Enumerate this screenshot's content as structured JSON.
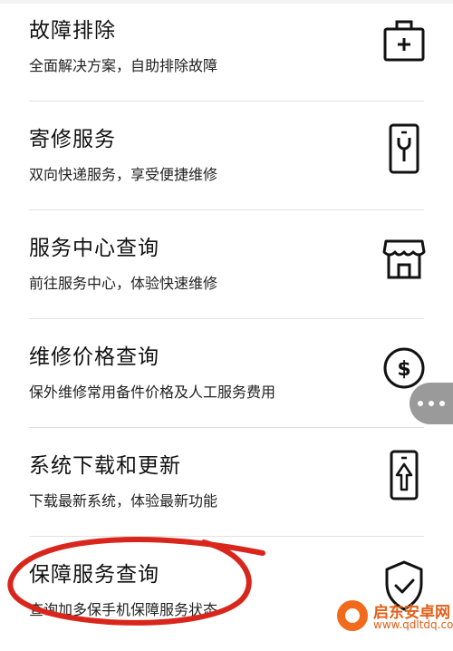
{
  "items": [
    {
      "title": "故障排除",
      "subtitle": "全面解决方案，自助排除故障",
      "icon": "first-aid-kit-icon"
    },
    {
      "title": "寄修服务",
      "subtitle": "双向快递服务，享受便捷维修",
      "icon": "phone-repair-icon"
    },
    {
      "title": "服务中心查询",
      "subtitle": "前往服务中心，体验快速维修",
      "icon": "store-icon"
    },
    {
      "title": "维修价格查询",
      "subtitle": "保外维修常用备件价格及人工服务费用",
      "icon": "dollar-icon"
    },
    {
      "title": "系统下载和更新",
      "subtitle": "下载最新系统，体验最新功能",
      "icon": "phone-update-icon"
    },
    {
      "title": "保障服务查询",
      "subtitle": "查询加多保手机保障服务状态",
      "icon": "shield-check-icon"
    }
  ],
  "floating_button": {
    "icon": "more-dots-icon"
  },
  "annotation": {
    "color": "#d9261c",
    "shape": "hand-drawn-circle"
  },
  "watermark": {
    "name": "启东安卓网",
    "url": "www.qdltdq.com",
    "color": "#e0601a"
  }
}
